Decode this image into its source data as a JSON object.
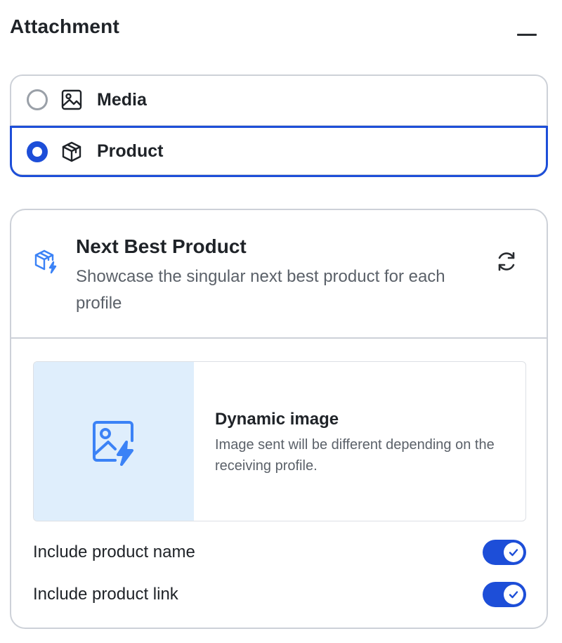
{
  "header": {
    "title": "Attachment",
    "collapse_icon": "minus-icon"
  },
  "attachment_types": {
    "options": [
      {
        "label": "Media",
        "icon": "image-icon",
        "selected": false
      },
      {
        "label": "Product",
        "icon": "box-icon",
        "selected": true
      }
    ]
  },
  "product_card": {
    "icon": "sparkle-box-icon",
    "title": "Next Best Product",
    "description": "Showcase the singular next best product for each profile",
    "refresh_icon": "refresh-icon",
    "dynamic_image": {
      "icon": "dynamic-image-icon",
      "title": "Dynamic image",
      "description": "Image sent will be different depending on the receiving profile."
    },
    "toggles": [
      {
        "label": "Include product name",
        "enabled": true
      },
      {
        "label": "Include product link",
        "enabled": true
      }
    ]
  },
  "colors": {
    "accent": "#1d4ed8",
    "icon_blue": "#3b82f6",
    "thumb_bg": "#dfeefc",
    "border": "#cdd1d8"
  }
}
